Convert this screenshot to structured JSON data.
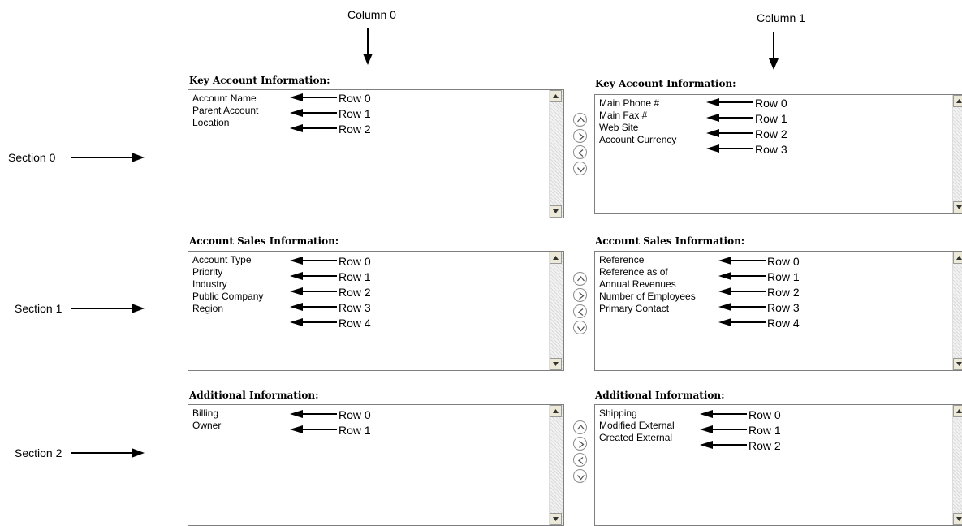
{
  "columns": [
    "Column 0",
    "Column 1"
  ],
  "sections": [
    "Section 0",
    "Section 1",
    "Section 2"
  ],
  "panels": {
    "s0c0": {
      "title": "Key Account Information:",
      "items": [
        "Account Name",
        "Parent Account",
        "Location"
      ],
      "rows": [
        "Row 0",
        "Row 1",
        "Row 2"
      ]
    },
    "s0c1": {
      "title": "Key Account Information:",
      "items": [
        "Main Phone #",
        "Main Fax #",
        "Web Site",
        "Account Currency"
      ],
      "rows": [
        "Row 0",
        "Row 1",
        "Row 2",
        "Row 3"
      ]
    },
    "s1c0": {
      "title": "Account Sales Information:",
      "items": [
        "Account Type",
        "Priority",
        "Industry",
        "Public Company",
        "Region"
      ],
      "rows": [
        "Row 0",
        "Row 1",
        "Row 2",
        "Row 3",
        "Row 4"
      ]
    },
    "s1c1": {
      "title": "Account Sales Information:",
      "items": [
        "Reference",
        "Reference as of",
        "Annual Revenues",
        "Number of Employees",
        "Primary Contact"
      ],
      "rows": [
        "Row 0",
        "Row 1",
        "Row 2",
        "Row 3",
        "Row 4"
      ]
    },
    "s2c0": {
      "title": "Additional Information:",
      "items": [
        "Billing",
        "Owner"
      ],
      "rows": [
        "Row 0",
        "Row 1"
      ]
    },
    "s2c1": {
      "title": "Additional Information:",
      "items": [
        "Shipping",
        "Modified External",
        "Created External"
      ],
      "rows": [
        "Row 0",
        "Row 1",
        "Row 2"
      ]
    }
  },
  "mover_icons": [
    "move-up-icon",
    "move-right-icon",
    "move-left-icon",
    "move-down-icon"
  ]
}
